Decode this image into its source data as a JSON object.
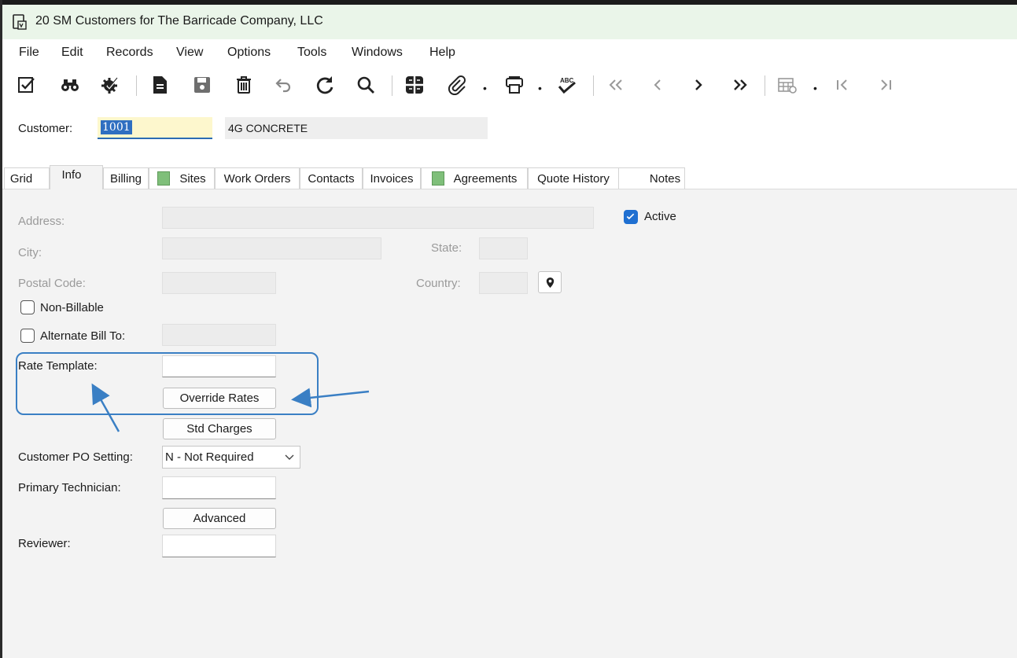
{
  "window": {
    "title": "20 SM Customers for The Barricade Company, LLC"
  },
  "menu": [
    "File",
    "Edit",
    "Records",
    "View",
    "Options",
    "Tools",
    "Windows",
    "Help"
  ],
  "toolbar": {
    "icons": [
      "edit-check-icon",
      "binoculars-icon",
      "settings-check-icon",
      "new-document-icon",
      "save-icon",
      "delete-icon",
      "undo-icon",
      "refresh-icon",
      "search-icon",
      "layout-icon",
      "attach-icon",
      "print-icon",
      "spellcheck-icon",
      "first-icon",
      "previous-icon",
      "next-icon",
      "last-icon",
      "grid-settings-icon",
      "go-first-icon",
      "go-last-icon"
    ]
  },
  "header": {
    "customer_label": "Customer:",
    "customer_id": "1001",
    "customer_name": "4G CONCRETE"
  },
  "tabs": [
    "Grid",
    "Info",
    "Billing",
    "Sites",
    "Work Orders",
    "Contacts",
    "Invoices",
    "Agreements",
    "Quote History",
    "Notes"
  ],
  "active_tab": "Info",
  "form": {
    "address_label": "Address:",
    "active_label": "Active",
    "active_checked": true,
    "city_label": "City:",
    "state_label": "State:",
    "postal_label": "Postal Code:",
    "country_label": "Country:",
    "non_billable_label": "Non-Billable",
    "alternate_bill_label": "Alternate Bill To:",
    "rate_template_label": "Rate Template:",
    "override_rates_button": "Override Rates",
    "std_charges_button": "Std Charges",
    "customer_po_label": "Customer PO Setting:",
    "customer_po_value": "N - Not Required",
    "primary_tech_label": "Primary Technician:",
    "advanced_button": "Advanced",
    "reviewer_label": "Reviewer:"
  },
  "colors": {
    "accent": "#3a7fc4",
    "title_bar": "#eaf5e9",
    "highlight": "#fdf7cd"
  }
}
